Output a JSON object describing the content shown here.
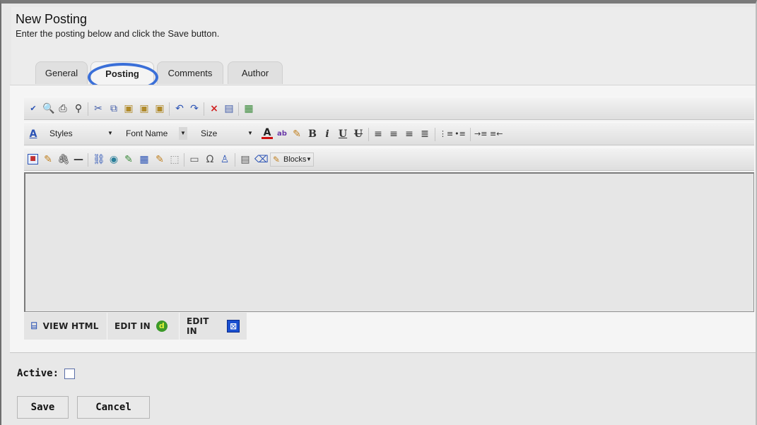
{
  "header": {
    "title": "New Posting",
    "subtitle": "Enter the posting below and click the Save button."
  },
  "tabs": [
    {
      "label": "General",
      "active": false
    },
    {
      "label": "Posting",
      "active": true
    },
    {
      "label": "Comments",
      "active": false
    },
    {
      "label": "Author",
      "active": false
    }
  ],
  "toolbar": {
    "styles_label": "Styles",
    "font_name_label": "Font Name",
    "size_label": "Size",
    "blocks_label": "Blocks",
    "bold_glyph": "B",
    "italic_glyph": "i",
    "underline_glyph": "U",
    "strike_glyph": "U"
  },
  "editor_footer": {
    "view_html_label": "VIEW HTML",
    "edit_in_1_label": "EDIT IN",
    "edit_in_2_label": "EDIT IN"
  },
  "form": {
    "active_label": "Active:",
    "active_checked": false,
    "save_label": "Save",
    "cancel_label": "Cancel"
  },
  "colors": {
    "highlight_ring": "#3a6fd8"
  }
}
